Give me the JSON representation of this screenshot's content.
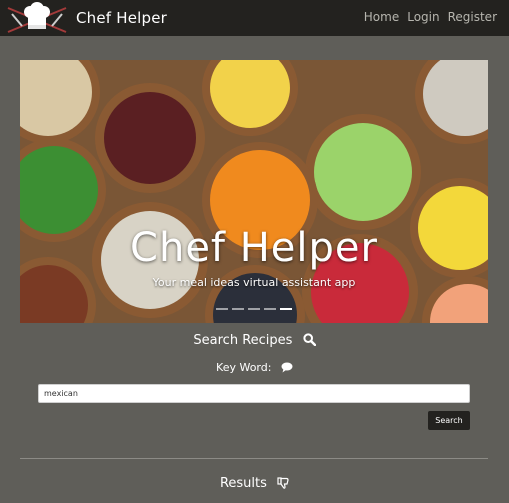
{
  "navbar": {
    "brand": "Chef Helper",
    "links": [
      "Home",
      "Login",
      "Register"
    ]
  },
  "hero": {
    "title": "Chef Helper",
    "subtitle": "Your meal ideas virtual assistant app",
    "slides": 5,
    "active_slide": 5
  },
  "search": {
    "heading": "Search Recipes",
    "keyword_label": "Key Word:",
    "input_value": "mexican",
    "button_label": "Search"
  },
  "results": {
    "heading": "Results"
  },
  "colors": {
    "navbar_bg": "#23221f",
    "page_bg": "#5f5e59",
    "button_bg": "#23221f"
  }
}
